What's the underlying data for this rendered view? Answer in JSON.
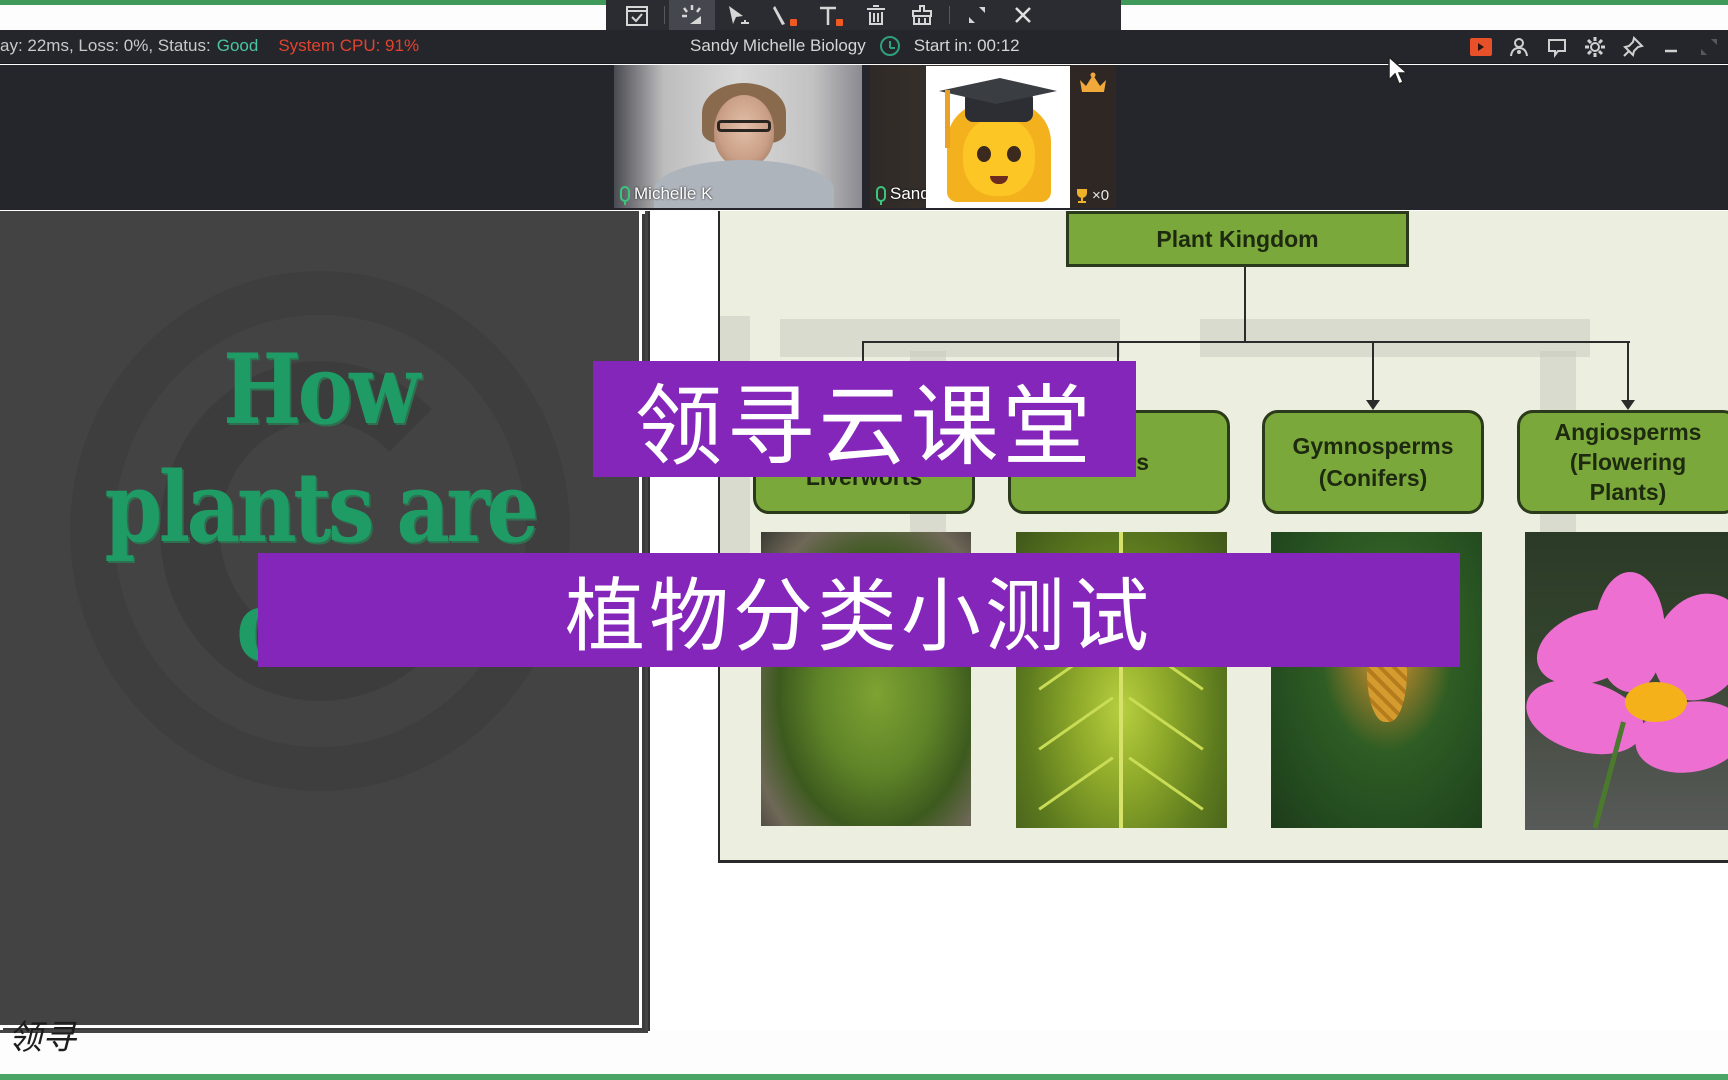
{
  "toolbar": {
    "items": [
      {
        "name": "select-tool",
        "icon": "checkbox-window-icon"
      },
      {
        "name": "laser-pointer-tool",
        "icon": "laser-icon",
        "active": true
      },
      {
        "name": "pointer-tool",
        "icon": "cursor-arrow-icon"
      },
      {
        "name": "pen-tool",
        "icon": "pen-icon"
      },
      {
        "name": "text-tool",
        "icon": "text-icon"
      },
      {
        "name": "delete-tool",
        "icon": "trash-icon"
      },
      {
        "name": "clear-tool",
        "icon": "broom-icon"
      },
      {
        "name": "collapse-tool",
        "icon": "collapse-icon"
      },
      {
        "name": "close-tool",
        "icon": "close-icon"
      }
    ],
    "accent_color": "#f05a22"
  },
  "status_bar": {
    "network_prefix": "ay: 22ms, Loss: 0%, Status:",
    "network_status": "Good",
    "cpu_text": "System CPU: 91%",
    "class_title": "Sandy Michelle Biology",
    "timer_label": "Start in: 00:12",
    "colors": {
      "good": "#49c5a0",
      "cpu_warning": "#e2432f",
      "timer_icon": "#2fa07a"
    },
    "right_buttons": [
      "record-icon",
      "members-icon",
      "chat-icon",
      "settings-icon",
      "pin-icon",
      "minimize-icon",
      "expand-icon"
    ]
  },
  "participants": [
    {
      "name": "Michelle K",
      "mic": "on"
    },
    {
      "name": "Sandy",
      "mic": "on",
      "avatar": "student-emoji",
      "trophies": "×0",
      "badge": "crown-icon"
    }
  ],
  "left_slide": {
    "title": "How plants are clas",
    "title_color": "#1f9c66"
  },
  "diagram": {
    "root": "Plant Kingdom",
    "children": [
      {
        "label": "Liverworts",
        "photo": "moss"
      },
      {
        "label": "s",
        "photo": "fern"
      },
      {
        "label": "Gymnosperms (Conifers)",
        "line1": "Gymnosperms",
        "line2": "(Conifers)",
        "photo": "cycad"
      },
      {
        "label": "Angiosperms (Flowering Plants)",
        "line1": "Angiosperms",
        "line2": "(Flowering",
        "line3": "Plants)",
        "photo": "flower"
      }
    ],
    "node_color": "#7ba83a"
  },
  "overlay": {
    "banner_1": "领寻云课堂",
    "banner_2": "植物分类小测试",
    "banner_color": "#8426ba",
    "corner_watermark": "领寻"
  }
}
